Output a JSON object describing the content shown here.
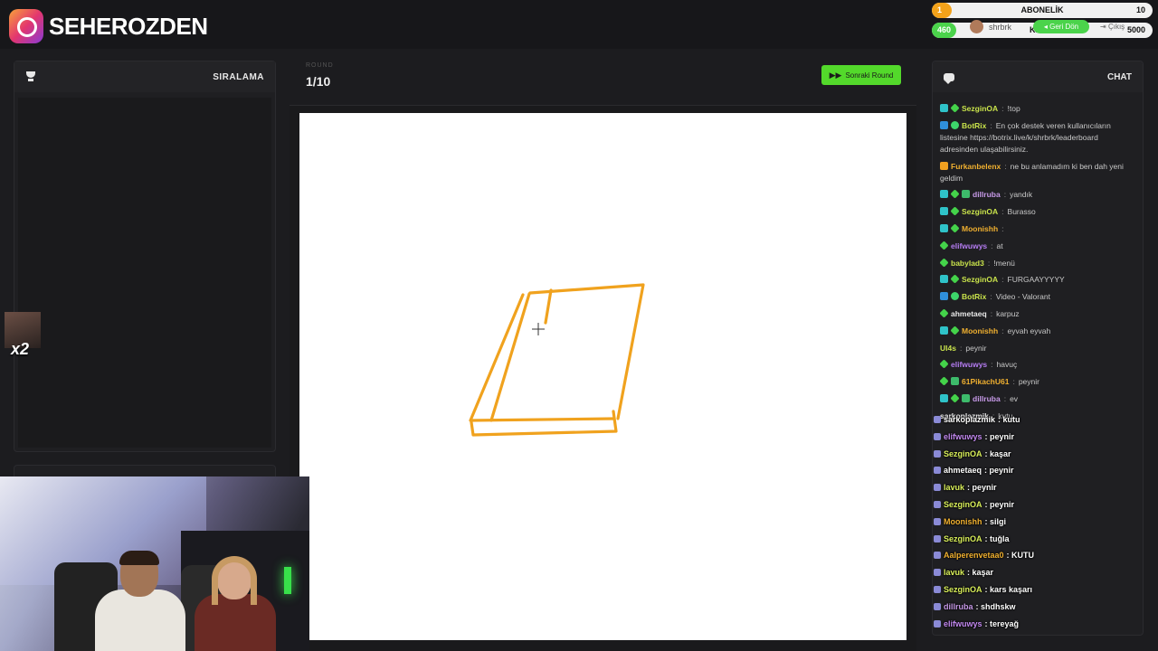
{
  "brand": {
    "name": "SEHEROZDEN"
  },
  "hud": {
    "sub_count": "1",
    "sub_title": "ABONELİK",
    "sub_goal": "10",
    "kicks_count": "460",
    "kicks_title": "KICKS",
    "kicks_goal": "5000",
    "user": "shrbrk",
    "back_label": "Geri Dön",
    "exit_label": "Çıkış"
  },
  "leaderboard": {
    "title": "SIRALAMA"
  },
  "multiplier": "x2",
  "round": {
    "label": "ROUND",
    "value": "1/10",
    "next_label": "Sonraki Round"
  },
  "chat": {
    "title": "CHAT",
    "messages": [
      {
        "user": "SezginOA",
        "color": "#c9e34b",
        "badges": [
          "mod",
          "sub"
        ],
        "text": "!top"
      },
      {
        "user": "BotRix",
        "color": "#c9e34b",
        "badges": [
          "bot",
          "ver"
        ],
        "text": "En çok destek veren kullanıcıların listesine https://botrix.live/k/shrbrk/leaderboard adresinden ulaşabilirsiniz."
      },
      {
        "user": "Furkanbelenx",
        "color": "#f0b030",
        "badges": [
          "orange"
        ],
        "text": "ne bu anlamadım ki ben dah yeni geldim"
      },
      {
        "user": "dillruba",
        "color": "#c79ae8",
        "badges": [
          "mod",
          "sub",
          "gift"
        ],
        "text": "yandık"
      },
      {
        "user": "SezginOA",
        "color": "#c9e34b",
        "badges": [
          "mod",
          "sub"
        ],
        "text": "Burasso"
      },
      {
        "user": "Moonishh",
        "color": "#f0b030",
        "badges": [
          "mod",
          "sub"
        ],
        "text": ""
      },
      {
        "user": "elifwuwys",
        "color": "#b57cf2",
        "badges": [
          "sub"
        ],
        "text": "at"
      },
      {
        "user": "babylad3",
        "color": "#c9e34b",
        "badges": [
          "sub"
        ],
        "text": "!menü"
      },
      {
        "user": "SezginOA",
        "color": "#c9e34b",
        "badges": [
          "mod",
          "sub"
        ],
        "text": "FURGAAYYYYY"
      },
      {
        "user": "BotRix",
        "color": "#c9e34b",
        "badges": [
          "bot",
          "ver"
        ],
        "text": "Video - Valorant"
      },
      {
        "user": "ahmetaeq",
        "color": "#e8e8e8",
        "badges": [
          "sub"
        ],
        "text": "karpuz"
      },
      {
        "user": "Moonishh",
        "color": "#f0b030",
        "badges": [
          "mod",
          "sub"
        ],
        "text": "eyvah eyvah"
      },
      {
        "user": "Ul4s",
        "color": "#c9e34b",
        "badges": [],
        "text": "peynir"
      },
      {
        "user": "elifwuwys",
        "color": "#b57cf2",
        "badges": [
          "sub"
        ],
        "text": "havuç"
      },
      {
        "user": "61PikachU61",
        "color": "#f0b030",
        "badges": [
          "sub",
          "gift"
        ],
        "text": "peynir"
      },
      {
        "user": "dillruba",
        "color": "#c79ae8",
        "badges": [
          "mod",
          "sub",
          "gift"
        ],
        "text": "ev"
      },
      {
        "user": "sarkoplazmik",
        "color": "#e8e8e8",
        "badges": [],
        "text": "kutu"
      }
    ]
  },
  "overlay_chat": [
    {
      "user": "sarkoplazmik",
      "color": "#ffffff",
      "text": "kutu"
    },
    {
      "user": "elifwuwys",
      "color": "#c48af2",
      "text": "peynir"
    },
    {
      "user": "SezginOA",
      "color": "#d9ef5a",
      "text": "kaşar"
    },
    {
      "user": "ahmetaeq",
      "color": "#ffffff",
      "text": "peynir"
    },
    {
      "user": "lavuk",
      "color": "#d9ef5a",
      "text": "peynir"
    },
    {
      "user": "SezginOA",
      "color": "#d9ef5a",
      "text": "peynir"
    },
    {
      "user": "Moonishh",
      "color": "#f0b030",
      "text": "silgi"
    },
    {
      "user": "SezginOA",
      "color": "#d9ef5a",
      "text": "tuğla"
    },
    {
      "user": "Aalperenvetaa0",
      "color": "#f0b030",
      "text": "KUTU"
    },
    {
      "user": "lavuk",
      "color": "#d9ef5a",
      "text": "kaşar"
    },
    {
      "user": "SezginOA",
      "color": "#d9ef5a",
      "text": "kars kaşarı"
    },
    {
      "user": "dillruba",
      "color": "#c79ae8",
      "text": "shdhskw"
    },
    {
      "user": "elifwuwys",
      "color": "#c48af2",
      "text": "tereyağ"
    }
  ]
}
